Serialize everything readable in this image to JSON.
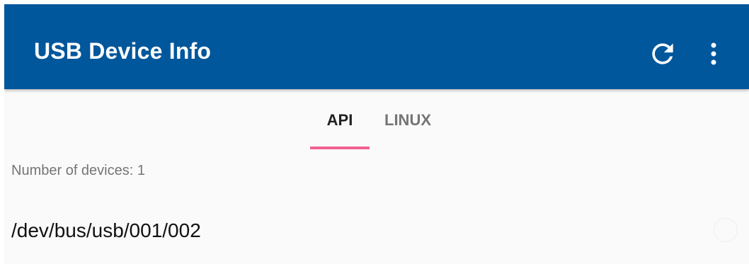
{
  "app": {
    "title": "USB Device Info",
    "header_color": "#01579b"
  },
  "toolbar": {
    "refresh_icon": "refresh-icon",
    "more_icon": "more-vert-icon"
  },
  "tabs": [
    {
      "label": "API",
      "selected": true
    },
    {
      "label": "LINUX",
      "selected": false
    }
  ],
  "tab_indicator_color": "#f06292",
  "devices": {
    "count_text": "Number of devices: 1",
    "items": [
      {
        "path": "/dev/bus/usb/001/002"
      }
    ]
  }
}
